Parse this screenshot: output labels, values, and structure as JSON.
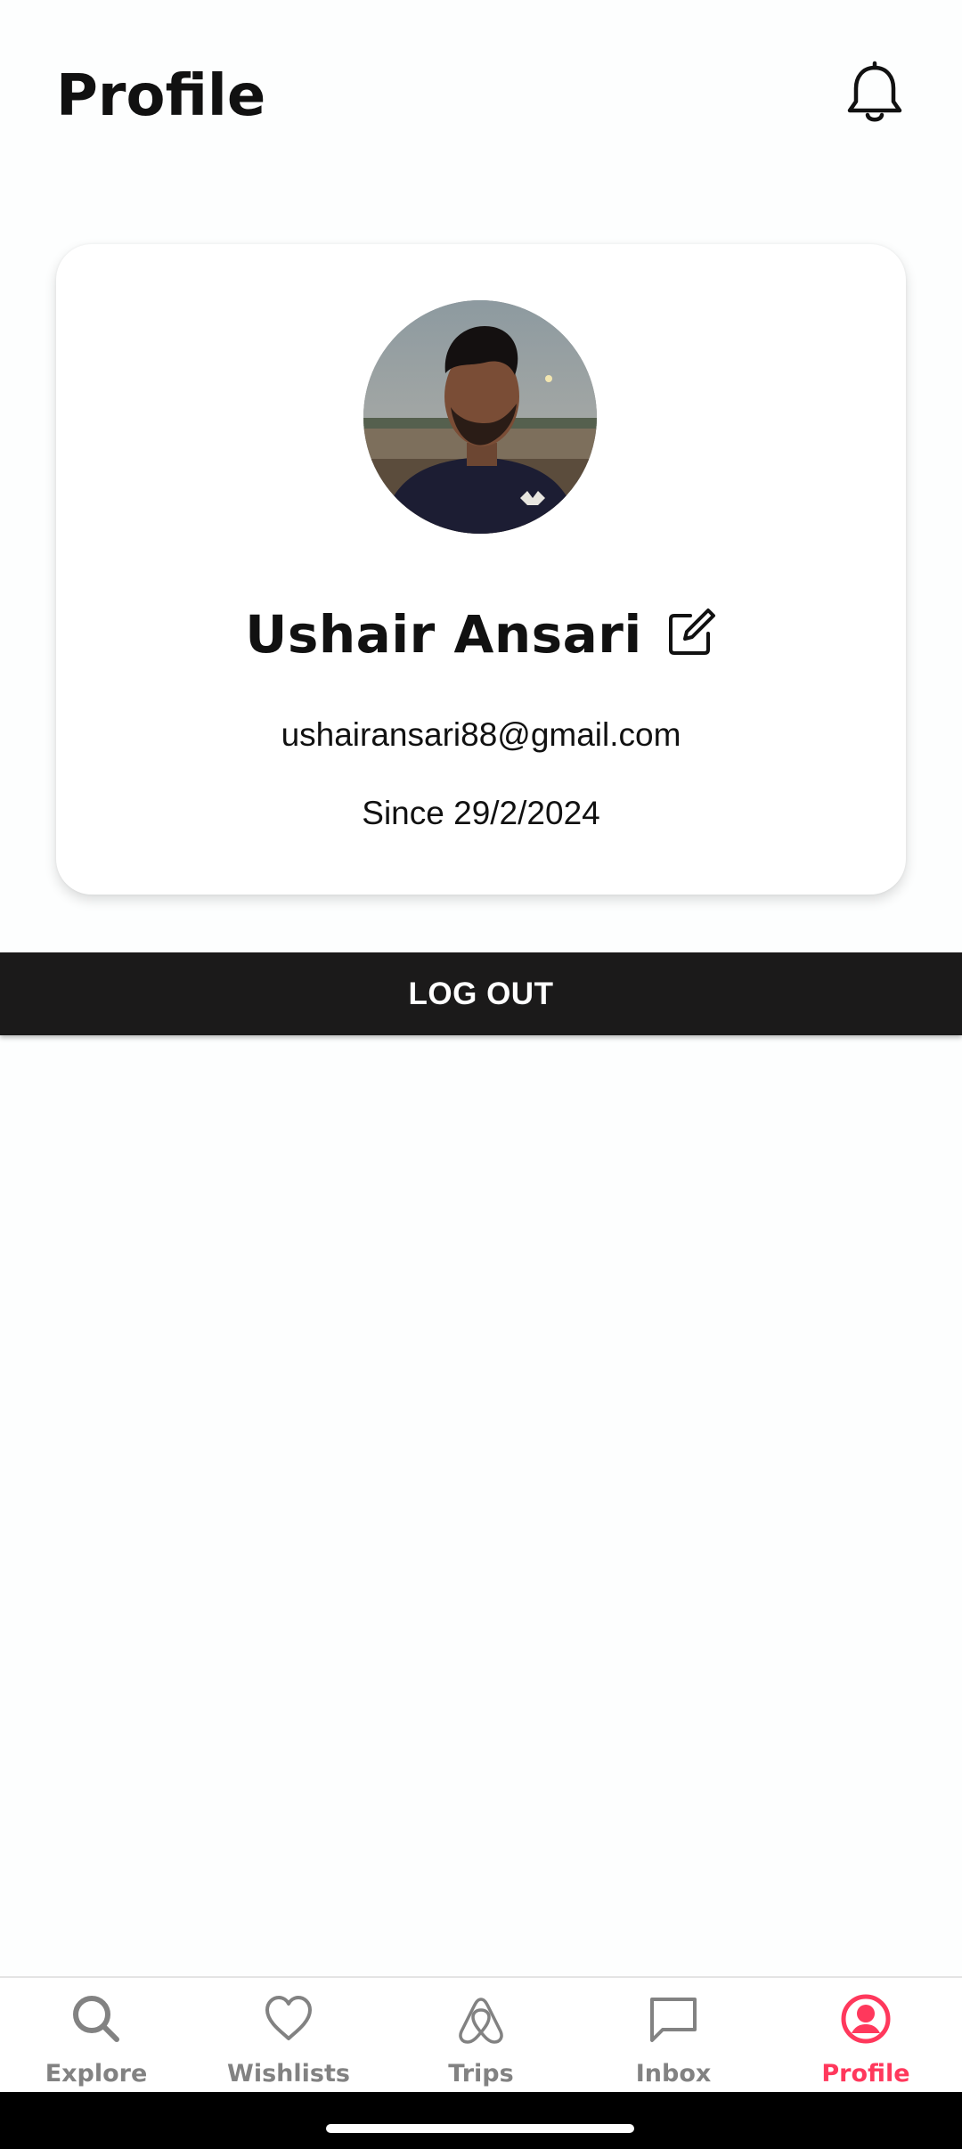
{
  "header": {
    "title": "Profile",
    "notification_icon": "bell-icon"
  },
  "profile": {
    "avatar_icon": "profile-photo",
    "name": "Ushair Ansari",
    "edit_icon": "edit-icon",
    "email": "ushairansari88@gmail.com",
    "since": "Since 29/2/2024"
  },
  "actions": {
    "logout_label": "LOG OUT"
  },
  "bottom_nav": {
    "active_color": "#ff385c",
    "inactive_color": "#828282",
    "items": [
      {
        "label": "Explore",
        "icon": "search-icon"
      },
      {
        "label": "Wishlists",
        "icon": "heart-icon"
      },
      {
        "label": "Trips",
        "icon": "airbnb-icon"
      },
      {
        "label": "Inbox",
        "icon": "message-icon"
      },
      {
        "label": "Profile",
        "icon": "user-circle-icon",
        "active": true
      }
    ]
  }
}
